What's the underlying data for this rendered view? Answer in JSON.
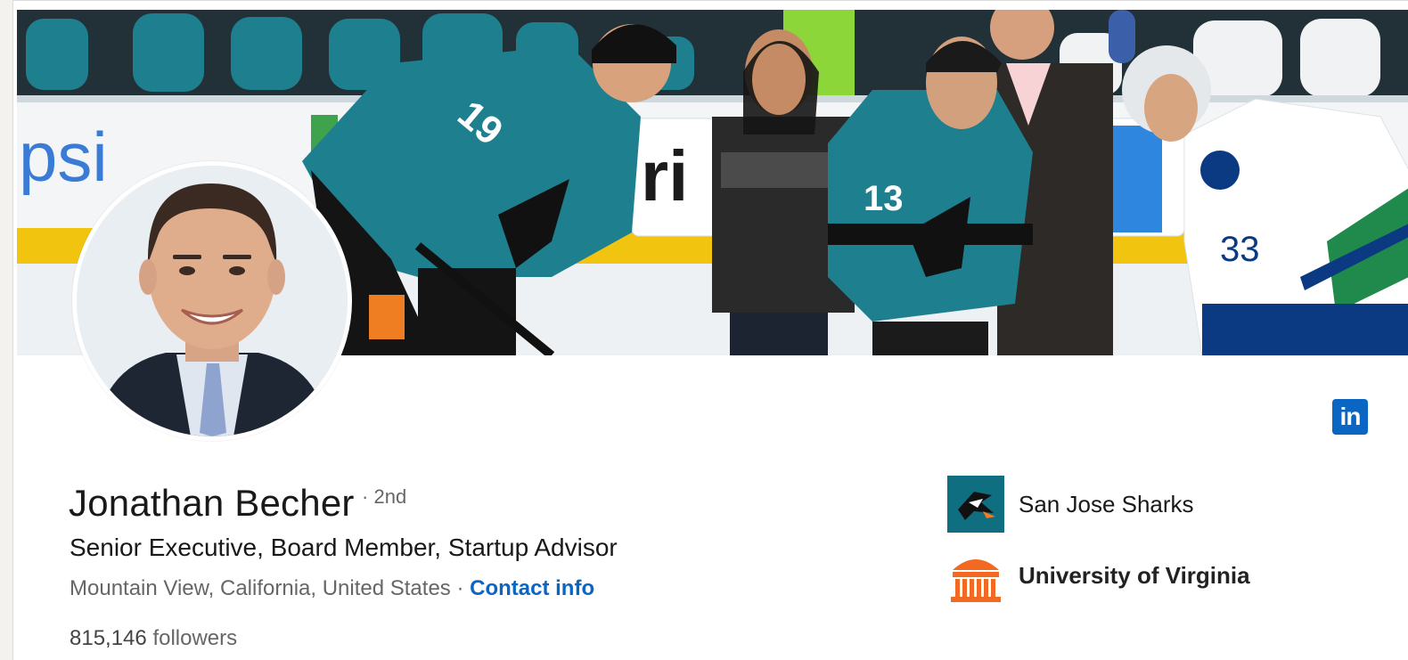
{
  "profile": {
    "name": "Jonathan Becher",
    "degree": "· 2nd",
    "headline": "Senior Executive, Board Member, Startup Advisor",
    "location": "Mountain View, California, United States ·",
    "contact_label": "Contact info",
    "followers_count": "815,146",
    "followers_label": "followers"
  },
  "banner": {
    "rink_board_text_left": "psi",
    "rink_board_text_mid": "ri",
    "player_numbers": [
      "19",
      "13",
      "33"
    ]
  },
  "badge": {
    "text": "in"
  },
  "organizations": [
    {
      "name": "San Jose Sharks",
      "logo": "sharks-logo-icon"
    },
    {
      "name": "University of Virginia",
      "logo": "rotunda-logo-icon"
    }
  ],
  "colors": {
    "link": "#0a66c2",
    "teal_jersey": "#1e7f8f",
    "uva_orange": "#f26a21",
    "sharks_bg": "#0f6f80"
  }
}
